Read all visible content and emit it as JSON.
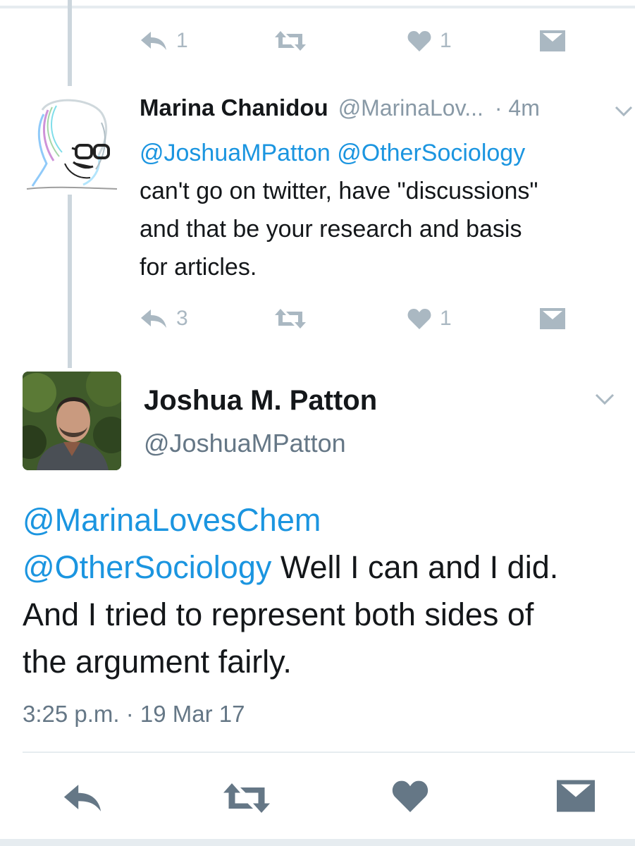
{
  "previous_tweet": {
    "reply_count": "1",
    "like_count": "1",
    "icons": [
      "reply-icon",
      "retweet-icon",
      "heart-icon",
      "dm-icon"
    ]
  },
  "reply_tweet": {
    "name": "Marina Chanidou",
    "handle": "@MarinaLov...",
    "time": "· 4m",
    "body": {
      "mention_1": "@JoshuaMPatton",
      "mention_2": "@OtherSociology",
      "line_1": "can't go on twitter, have \"discussions\"",
      "line_2": "and that be your research and basis",
      "line_3": "for articles."
    },
    "reply_count": "3",
    "like_count": "1"
  },
  "main_tweet": {
    "name": "Joshua M. Patton",
    "handle": "@JoshuaMPatton",
    "body": {
      "mention_1": "@MarinaLovesChem",
      "mention_2": "@OtherSociology",
      "text_1": " Well I can and I did.",
      "line_3": "And I tried to represent both sides of",
      "line_4": "the argument fairly."
    },
    "timestamp": "3:25 p.m. · 19 Mar 17"
  },
  "colors": {
    "link": "#1b95e0",
    "icon_light": "#aab8c2",
    "icon_dark": "#657786",
    "thread_line": "#ccd6dd"
  }
}
